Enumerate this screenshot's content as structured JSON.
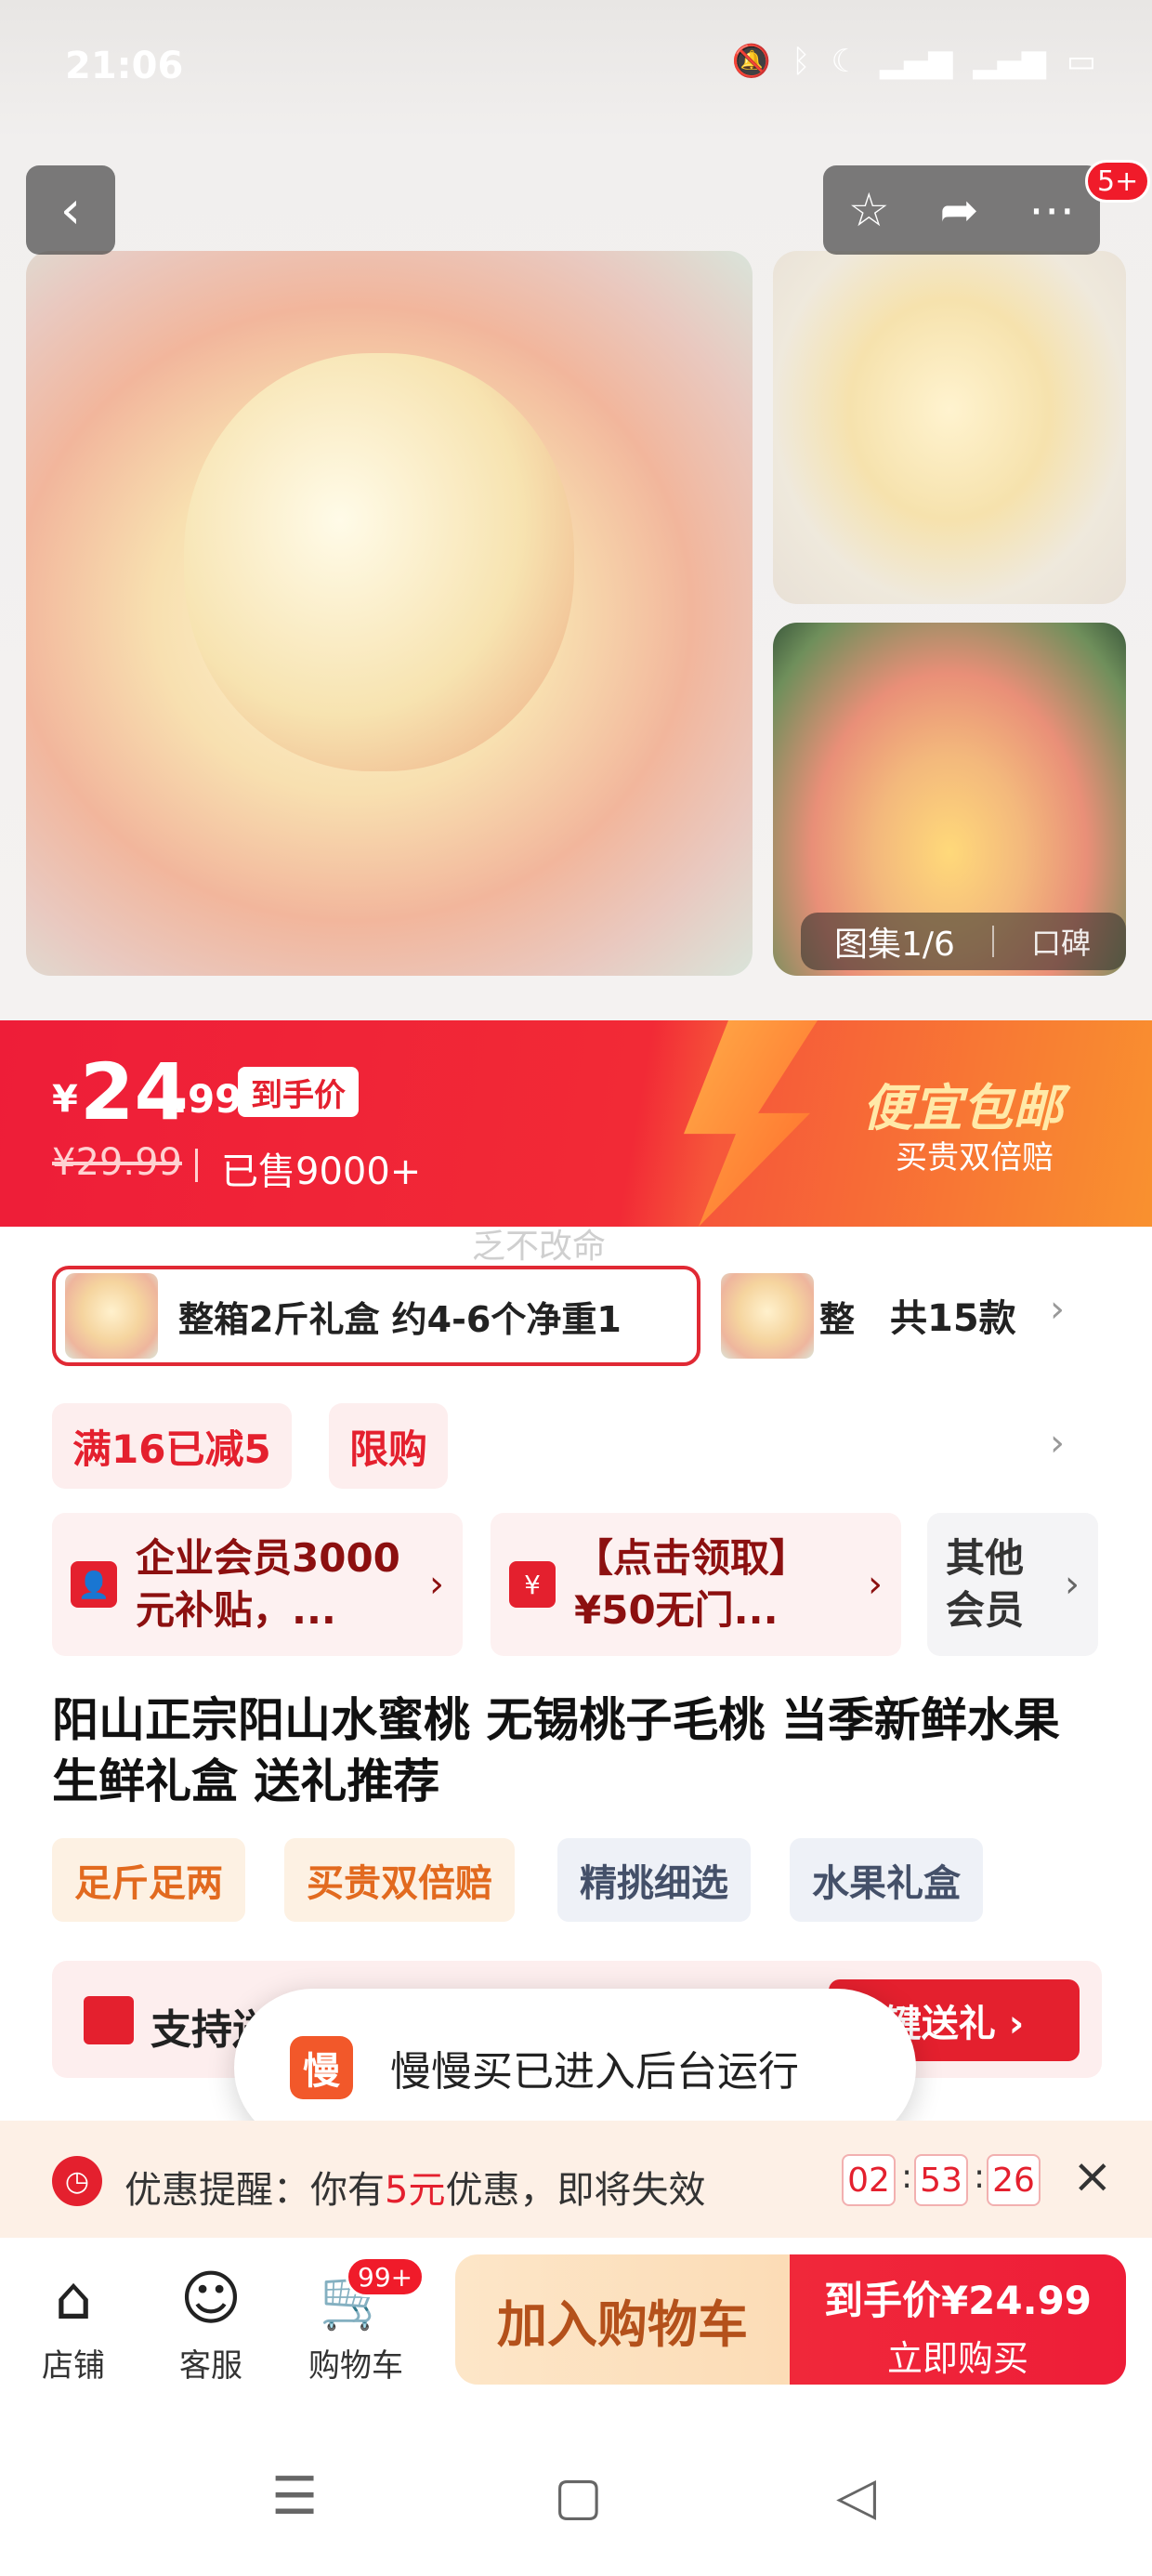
{
  "status_bar": {
    "time": "21:06",
    "icons": [
      "mute-icon",
      "bluetooth-icon",
      "moon-icon",
      "signal-5g-icon",
      "signal-5g-icon",
      "battery-icon"
    ]
  },
  "header": {
    "cart_badge": "5+"
  },
  "gallery": {
    "counter": "图集1/6",
    "review_label": "口碑"
  },
  "price": {
    "currency": "¥",
    "integer": "24",
    "decimal": ".99",
    "tag": "到手价",
    "original": "¥29.99",
    "sold": "已售9000+",
    "promo_title": "便宜包邮",
    "promo_sub": "买贵双倍赔"
  },
  "watermark": "乏不改命",
  "sku": {
    "selected": "整箱2斤礼盒 约4-6个净重1",
    "next": "整",
    "count": "共15款"
  },
  "chips": [
    "满16已减5",
    "限购"
  ],
  "benefits": [
    {
      "icon": "person-icon",
      "text": "企业会员3000元补贴，..."
    },
    {
      "icon": "coupon-icon",
      "text": "【点击领取】¥50无门..."
    },
    {
      "icon": "",
      "text": "其他会员"
    }
  ],
  "product_title": "阳山正宗阳山水蜜桃 无锡桃子毛桃 当季新鲜水果生鲜礼盒 送礼推荐",
  "tags": [
    "足斤足两",
    "买贵双倍赔",
    "精挑细选",
    "水果礼盒"
  ],
  "gift": {
    "label": "支持送",
    "button": "键送礼 ›"
  },
  "toast": {
    "app_glyph": "慢",
    "message": "慢慢买已进入后台运行"
  },
  "reminder": {
    "prefix": "优惠提醒：你有",
    "amount": "5元",
    "suffix": "优惠，即将失效",
    "countdown": [
      "02",
      "53",
      "26"
    ]
  },
  "bottom_bar": {
    "shop": "店铺",
    "service": "客服",
    "cart": "购物车",
    "cart_badge": "99+",
    "add_to_cart": "加入购物车",
    "buy_line1": "到手价¥24.99",
    "buy_line2": "立即购买"
  },
  "colors": {
    "accent": "#e4202e",
    "price_band": "#ee1d38",
    "cart_button": "#fde6c8"
  }
}
